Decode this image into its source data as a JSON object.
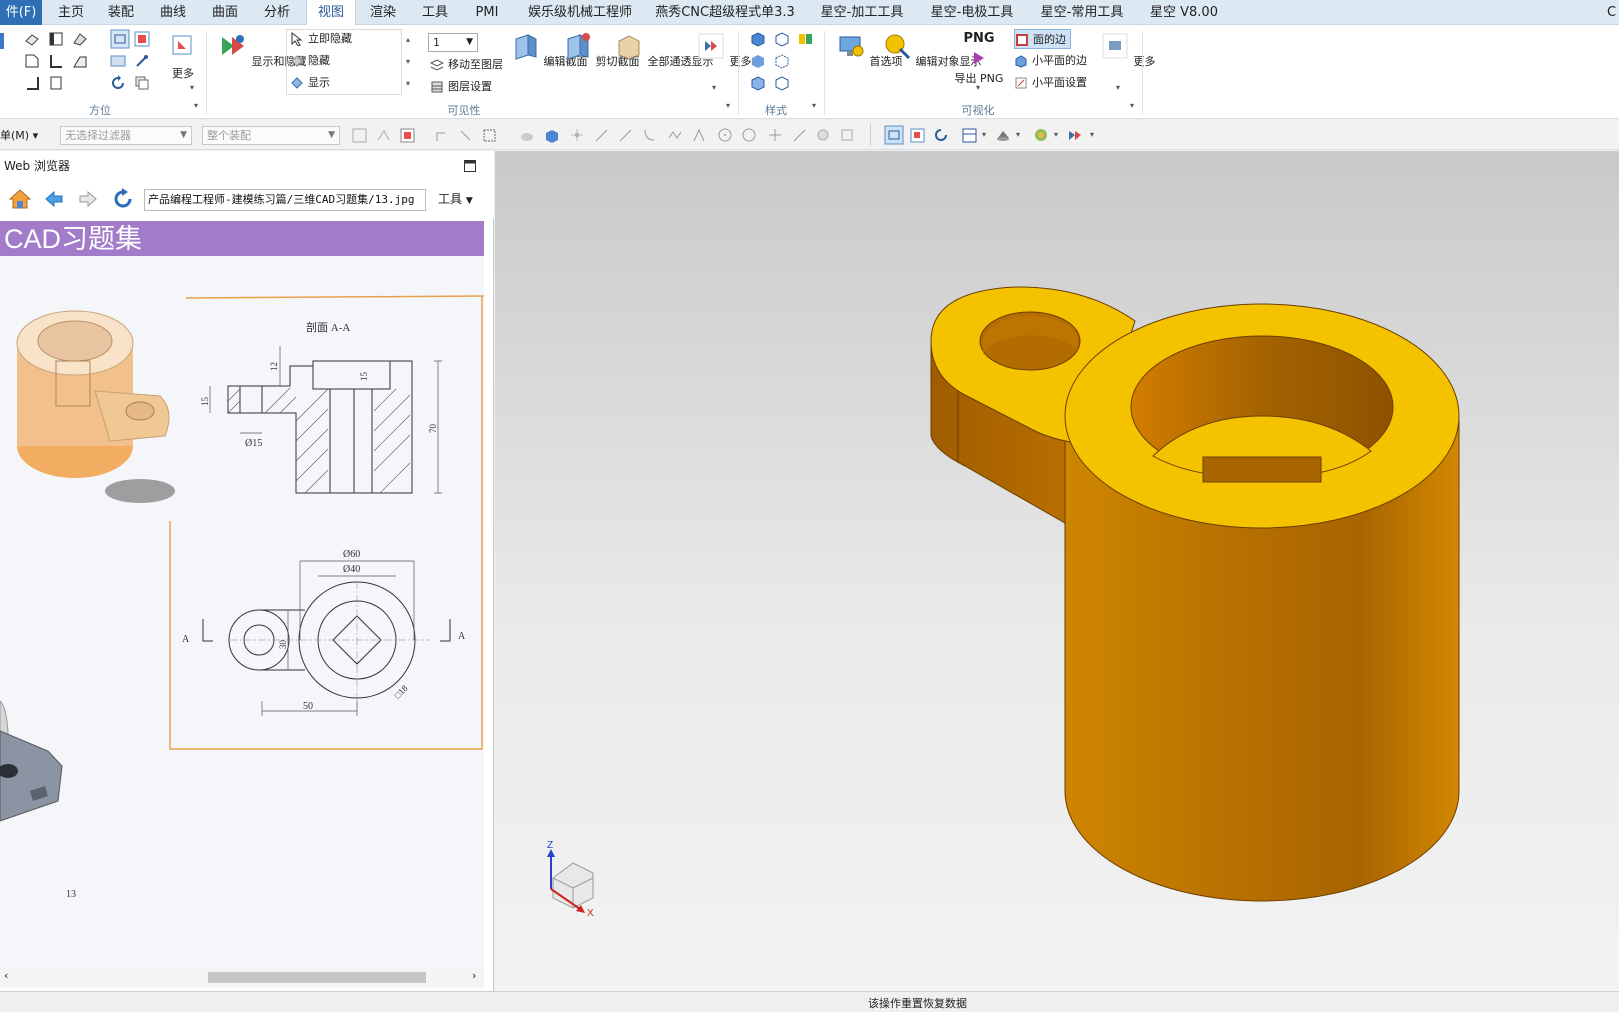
{
  "menubar": {
    "file": "件(F)",
    "tabs": [
      "主页",
      "装配",
      "曲线",
      "曲面",
      "分析",
      "视图",
      "渲染",
      "工具",
      "PMI",
      "娱乐级机械工程师",
      "燕秀CNC超级程式单3.3",
      "星空-加工工具",
      "星空-电极工具",
      "星空-常用工具",
      "星空 V8.00"
    ],
    "active": "视图",
    "right_edge": "C"
  },
  "ribbon": {
    "orient_group": {
      "more": "更多",
      "label": "方位"
    },
    "visibility_group": {
      "show_hide": "显示和隐藏",
      "immediate_hide": "立即隐藏",
      "hide": "隐藏",
      "show": "显示",
      "layer_value": "1",
      "move_to_layer": "移动至图层",
      "layer_settings": "图层设置",
      "edit_section": "编辑截面",
      "clip_section": "剪切截面",
      "all_transparent": "全部通透显示",
      "more": "更多",
      "label": "可见性"
    },
    "style_group": {
      "label": "样式"
    },
    "visualize_group": {
      "preferences": "首选项",
      "edit_obj_display": "编辑对象显示",
      "png_icon": "PNG",
      "export_png": "导出 PNG",
      "face_edges": "面的边",
      "small_face_edges": "小平面的边",
      "small_face_settings": "小平面设置",
      "more": "更多",
      "label": "可视化"
    }
  },
  "toolbar2": {
    "menu": "单(M)",
    "filter": "无选择过滤器",
    "assembly": "整个装配"
  },
  "browser": {
    "title": "Web 浏览器",
    "url": "产品编程工程师-建模练习篇/三维CAD习题集/13.jpg",
    "tools": "工具",
    "page": {
      "banner": "CAD习题集",
      "section_label": "剖面 A-A",
      "dims": {
        "d15": "Ø15",
        "h12": "12",
        "h15": "15",
        "l15": "15",
        "h70": "70",
        "d60": "Ø60",
        "d40": "Ø40",
        "h30": "30",
        "w50": "50",
        "sq18": "□18",
        "a_left": "A",
        "a_right": "A"
      },
      "page_number": "13"
    }
  },
  "status": {
    "message": "该操作重置恢复数据"
  },
  "colors": {
    "part_top": "#f5c200",
    "part_side": "#d88a00",
    "part_dark": "#9a5a00",
    "banner": "#a27bc9",
    "accent": "#2a5a9c"
  }
}
